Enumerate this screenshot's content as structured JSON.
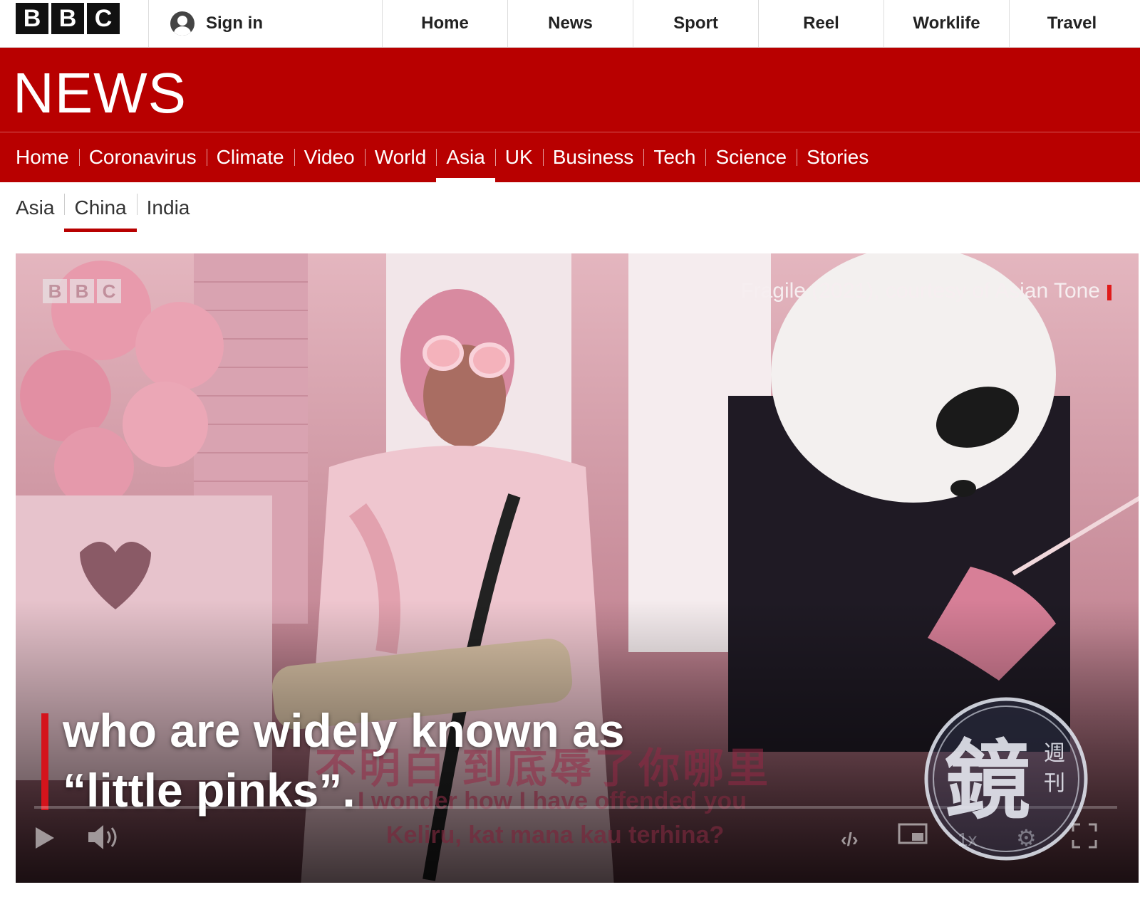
{
  "topnav": {
    "logo_letters": [
      "B",
      "B",
      "C"
    ],
    "sign_in": "Sign in",
    "links": [
      "Home",
      "News",
      "Sport",
      "Reel",
      "Worklife",
      "Travel"
    ]
  },
  "brand": {
    "wordmark": "NEWS",
    "color": "#b80000"
  },
  "section_nav": {
    "items": [
      "Home",
      "Coronavirus",
      "Climate",
      "Video",
      "World",
      "Asia",
      "UK",
      "Business",
      "Tech",
      "Science",
      "Stories"
    ],
    "active": "Asia"
  },
  "sub_nav": {
    "items": [
      "Asia",
      "China",
      "India"
    ],
    "active": "China"
  },
  "video": {
    "watermark_letters": [
      "B",
      "B",
      "C"
    ],
    "credit": "Fragile (2021), courtesy of Asian Tone",
    "caption_line1": "who are widely known as",
    "caption_line2": "“little pinks”.",
    "subtitle_cn": "不明白 到底辱了你哪里",
    "subtitle_en": "I wonder how I have offended you",
    "subtitle_ms": "Keliru, kat mana kau terhina?",
    "speed": "1x",
    "badge_text": "鏡週刊",
    "icons": [
      "play-icon",
      "volume-icon",
      "embed-icon",
      "picture-in-picture-icon",
      "settings-gear-icon",
      "fullscreen-icon"
    ]
  }
}
